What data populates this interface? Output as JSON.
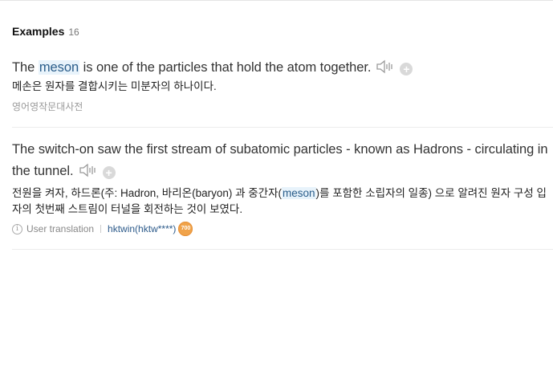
{
  "section": {
    "title": "Examples",
    "count": "16"
  },
  "examples": [
    {
      "en_before": "The ",
      "en_highlight": "meson",
      "en_after": " is one of the particles that hold the atom together.",
      "ko": "메손은 원자를 결합시키는 미분자의 하나이다.",
      "source": "영어영작문대사전"
    },
    {
      "en": "The switch-on saw the first stream of subatomic particles - known as Hadrons - circulating in the tunnel.",
      "ko_before": "전원을 켜자, 하드론(주: Hadron, 바리온(baryon) 과 중간자(",
      "ko_highlight": "meson",
      "ko_after": ")를 포함한 소립자의 일종) 으로 알려진 원자 구성 입자의 첫번째 스트림이 터널을 회전하는 것이 보였다.",
      "translation_label": "User translation",
      "user": "hktwin(hktw****)",
      "badge": "700"
    }
  ],
  "icons": {
    "audio": "speaker-icon",
    "add": "plus-icon",
    "info": "info-icon"
  },
  "colors": {
    "highlight_bg": "#e8f3fb",
    "highlight_text": "#2a5d8a",
    "badge": "#f0a34a"
  }
}
